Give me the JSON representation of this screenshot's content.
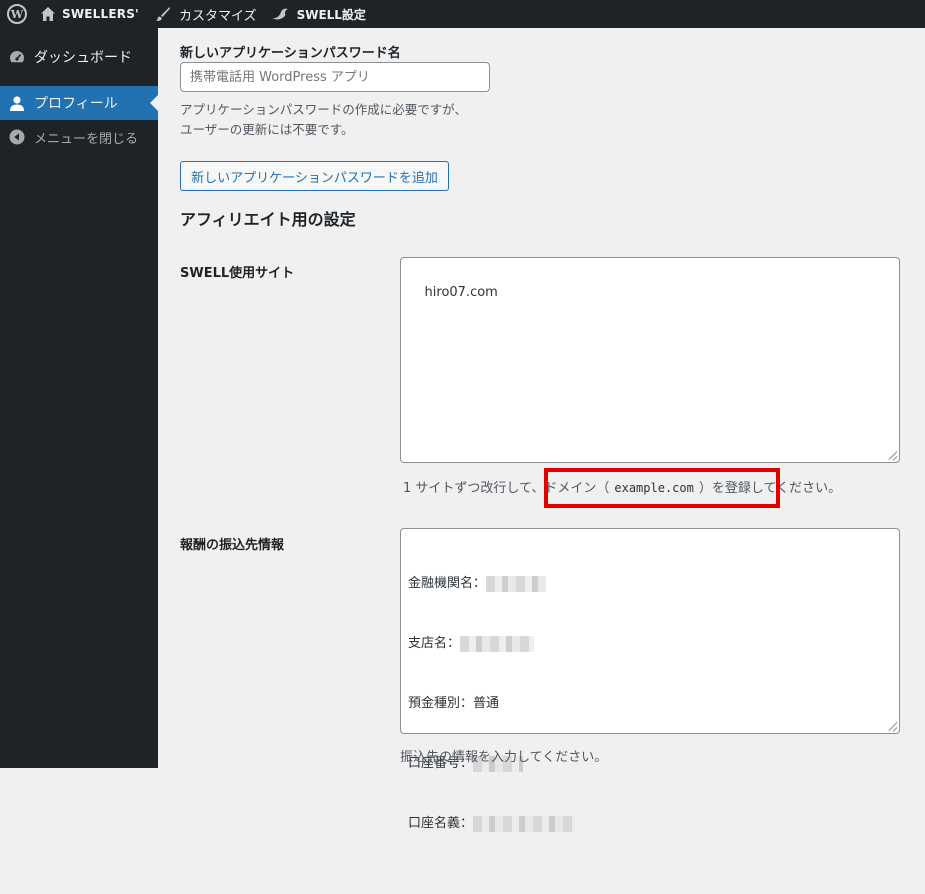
{
  "adminbar": {
    "site_name": "SWELLERS'",
    "customize_label": "カスタマイズ",
    "swell_settings_label": "SWELL設定"
  },
  "sidebar": {
    "items": [
      {
        "label": "ダッシュボード",
        "icon": "dashboard-icon"
      },
      {
        "label": "プロフィール",
        "icon": "user-icon",
        "active": true
      },
      {
        "label": "メニューを閉じる",
        "icon": "collapse-icon"
      }
    ]
  },
  "app_password": {
    "label": "新しいアプリケーションパスワード名",
    "placeholder": "携帯電話用 WordPress アプリ",
    "desc_line1": "アプリケーションパスワードの作成に必要ですが、",
    "desc_line2": "ユーザーの更新には不要です。",
    "add_button": "新しいアプリケーションパスワードを追加"
  },
  "affiliate": {
    "section_title": "アフィリエイト用の設定",
    "site_label": "SWELL使用サイト",
    "site_value": "hiro07.com",
    "site_hint_pre": "1 サイトずつ改行して、ドメイン（",
    "site_hint_code": "example.com",
    "site_hint_post": "）を登録してください。",
    "bank_label": "報酬の振込先情報",
    "bank_lines": [
      {
        "label": "金融機関名："
      },
      {
        "label": "支店名："
      },
      {
        "label": "預金種別：普通"
      },
      {
        "label": "口座番号："
      },
      {
        "label": "口座名義："
      }
    ],
    "bank_hint": "振込先の情報を入力してください。"
  },
  "colors": {
    "admin_dark": "#1d2327",
    "accent_blue": "#2271b1",
    "highlight_red": "#e00000",
    "background": "#f0f0f1"
  }
}
